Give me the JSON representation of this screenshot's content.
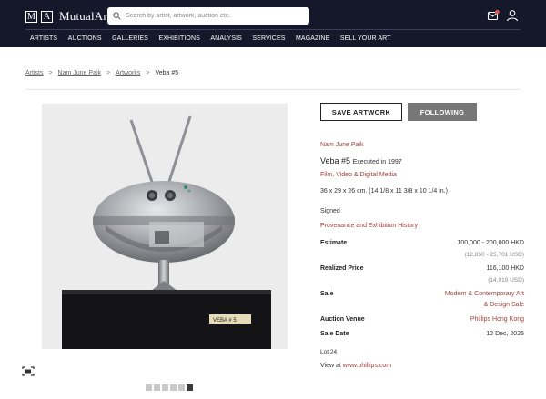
{
  "header": {
    "logo_mark_1": "M",
    "logo_mark_2": "A",
    "logo_text": "MutualArt",
    "search_placeholder": "Search by artist, artwork, auction etc.",
    "icons": [
      "search-icon",
      "notifications-icon",
      "user-icon"
    ]
  },
  "nav": {
    "items": [
      "ARTISTS",
      "AUCTIONS",
      "GALLERIES",
      "EXHIBITIONS",
      "ANALYSIS",
      "SERVICES",
      "MAGAZINE",
      "SELL YOUR ART"
    ]
  },
  "breadcrumb": {
    "items": [
      "Artists",
      "Nam June Paik",
      "Artworks"
    ],
    "current": "Veba #5",
    "separator": ">"
  },
  "gallery": {
    "image_count": 6,
    "active_index": 5,
    "plaque_text": "VEBA # 5"
  },
  "actions": {
    "save_label": "SAVE ARTWORK",
    "follow_label": "FOLLOWING"
  },
  "artwork": {
    "artist": "Nam June Paik",
    "title": "Veba #5",
    "executed": "Executed in 1997",
    "medium": "Film, Video & Digital Media",
    "dimensions": "36 x 29 x 26 cm. (14 1/8 x 11 3/8 x 10 1/4 in.)",
    "signed": "Signed",
    "provenance_link": "Provenance and Exhibition History"
  },
  "sale": {
    "estimate_label": "Estimate",
    "estimate_value": "100,000 - 200,000 HKD",
    "estimate_usd": "(12,850 - 25,701 USD)",
    "realized_label": "Realized Price",
    "realized_value": "116,100 HKD",
    "realized_usd": "(14,919 USD)",
    "sale_label": "Sale",
    "sale_line_1": "Modern & Contemporary Art",
    "sale_line_2": "& Design Sale",
    "venue_label": "Auction Venue",
    "venue_value": "Phillips Hong Kong",
    "date_label": "Sale Date",
    "date_value": "12 Dec, 2025",
    "lot": "Lot 24",
    "view_at_prefix": "View at",
    "view_at_link": "www.phillips.com"
  },
  "colors": {
    "header_bg": "#14182a",
    "accent_link": "#a0403c",
    "follow_button": "#777777"
  }
}
